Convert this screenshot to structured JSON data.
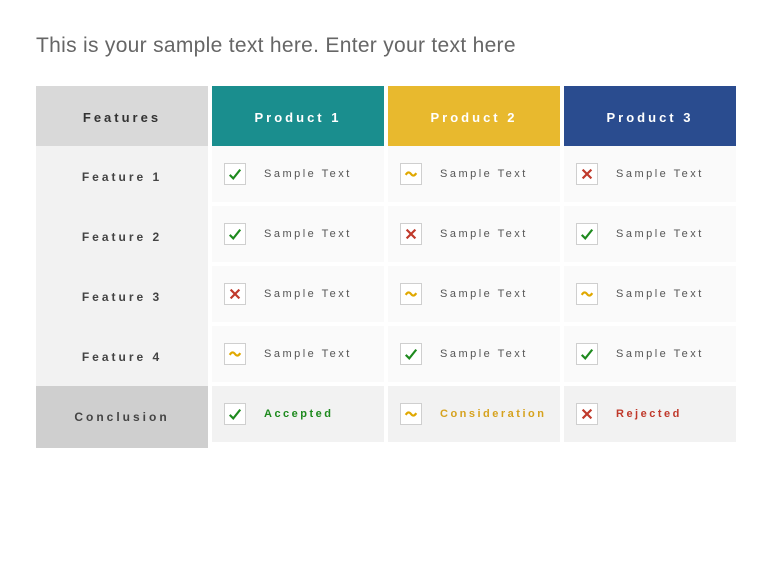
{
  "title": "This is your sample text here. Enter your text here",
  "headers": {
    "features": "Features",
    "p1": "Product 1",
    "p2": "Product 2",
    "p3": "Product 3"
  },
  "icons": {
    "check": "check",
    "cross": "cross",
    "tilde": "tilde"
  },
  "rows": [
    {
      "label": "Feature 1",
      "p1": {
        "icon": "check",
        "text": "Sample Text"
      },
      "p2": {
        "icon": "tilde",
        "text": "Sample Text"
      },
      "p3": {
        "icon": "cross",
        "text": "Sample Text"
      }
    },
    {
      "label": "Feature 2",
      "p1": {
        "icon": "check",
        "text": "Sample Text"
      },
      "p2": {
        "icon": "cross",
        "text": "Sample Text"
      },
      "p3": {
        "icon": "check",
        "text": "Sample Text"
      }
    },
    {
      "label": "Feature 3",
      "p1": {
        "icon": "cross",
        "text": "Sample Text"
      },
      "p2": {
        "icon": "tilde",
        "text": "Sample Text"
      },
      "p3": {
        "icon": "tilde",
        "text": "Sample Text"
      }
    },
    {
      "label": "Feature 4",
      "p1": {
        "icon": "tilde",
        "text": "Sample Text"
      },
      "p2": {
        "icon": "check",
        "text": "Sample Text"
      },
      "p3": {
        "icon": "check",
        "text": "Sample Text"
      }
    }
  ],
  "conclusion": {
    "label": "Conclusion",
    "p1": {
      "icon": "check",
      "text": "Accepted",
      "class": "accepted"
    },
    "p2": {
      "icon": "tilde",
      "text": "Consideration",
      "class": "consider"
    },
    "p3": {
      "icon": "cross",
      "text": "Rejected",
      "class": "rejected"
    }
  },
  "chart_data": {
    "type": "table",
    "title": "This is your sample text here. Enter your text here",
    "columns": [
      "Features",
      "Product 1",
      "Product 2",
      "Product 3"
    ],
    "rows": [
      [
        "Feature 1",
        "check: Sample Text",
        "tilde: Sample Text",
        "cross: Sample Text"
      ],
      [
        "Feature 2",
        "check: Sample Text",
        "cross: Sample Text",
        "check: Sample Text"
      ],
      [
        "Feature 3",
        "cross: Sample Text",
        "tilde: Sample Text",
        "tilde: Sample Text"
      ],
      [
        "Feature 4",
        "tilde: Sample Text",
        "check: Sample Text",
        "check: Sample Text"
      ],
      [
        "Conclusion",
        "Accepted",
        "Consideration",
        "Rejected"
      ]
    ]
  }
}
